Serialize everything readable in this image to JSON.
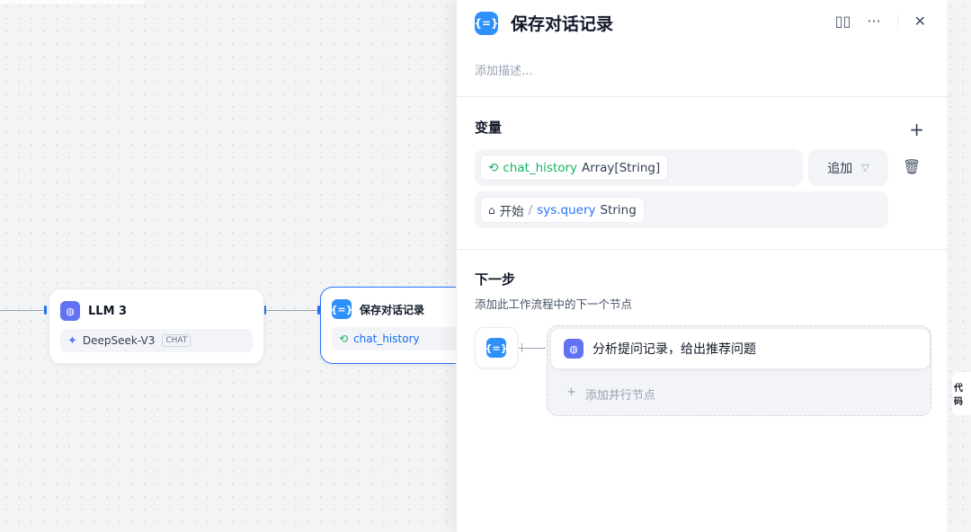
{
  "canvas": {
    "llm_node": {
      "title": "LLM 3",
      "model_name": "DeepSeek-V3",
      "model_mode": "CHAT",
      "icon": "brain-icon"
    },
    "assigner_node": {
      "title": "保存对话记录",
      "variable": "chat_history",
      "icon": "variable-braces-icon"
    },
    "partial_node_label": "代码"
  },
  "panel": {
    "title": "保存对话记录",
    "description_placeholder": "添加描述...",
    "actions": {
      "help_icon": "book-icon",
      "more_icon": "more-icon",
      "close_icon": "close-icon"
    },
    "variables": {
      "section_title": "变量",
      "add_icon": "plus-icon",
      "assigned_variable": {
        "name": "chat_history",
        "type": "Array[String]"
      },
      "operation": "追加",
      "delete_icon": "trash-icon",
      "value_variable": {
        "source": "开始",
        "separator": "/",
        "name": "sys.query",
        "type": "String"
      }
    },
    "next_step": {
      "section_title": "下一步",
      "subtitle": "添加此工作流程中的下一个节点",
      "next_node_title": "分析提问记录，给出推荐问题",
      "add_parallel_label": "添加并行节点",
      "add_parallel_icon": "+"
    }
  },
  "colors": {
    "accent_blue": "#2970ff",
    "llm_purple": "#6172f3",
    "variable_green": "#16b364"
  }
}
